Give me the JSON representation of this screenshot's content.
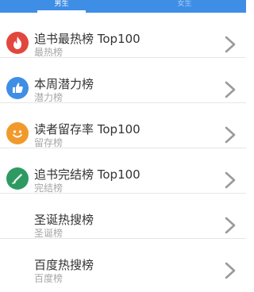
{
  "tabs": {
    "male_label": "男生",
    "female_label": "女生",
    "active": "male"
  },
  "colors": {
    "tab_bar": "#3f8ee6",
    "hot_icon": "#e2473d",
    "potential_icon": "#3f8ee6",
    "retention_icon": "#f19a2c",
    "finished_icon": "#2e9a62",
    "chevron": "#9a9a9a"
  },
  "rankings": [
    {
      "title": "追书最热榜 Top100",
      "subtitle": "最热榜",
      "icon": "flame-icon"
    },
    {
      "title": "本周潜力榜",
      "subtitle": "潜力榜",
      "icon": "thumbs-up-icon"
    },
    {
      "title": "读者留存率 Top100",
      "subtitle": "留存榜",
      "icon": "smiley-face-icon"
    },
    {
      "title": "追书完结榜 Top100",
      "subtitle": "完结榜",
      "icon": "pen-nib-icon"
    },
    {
      "title": "圣诞热搜榜",
      "subtitle": "圣诞榜",
      "icon": ""
    },
    {
      "title": "百度热搜榜",
      "subtitle": "百度榜",
      "icon": ""
    }
  ]
}
